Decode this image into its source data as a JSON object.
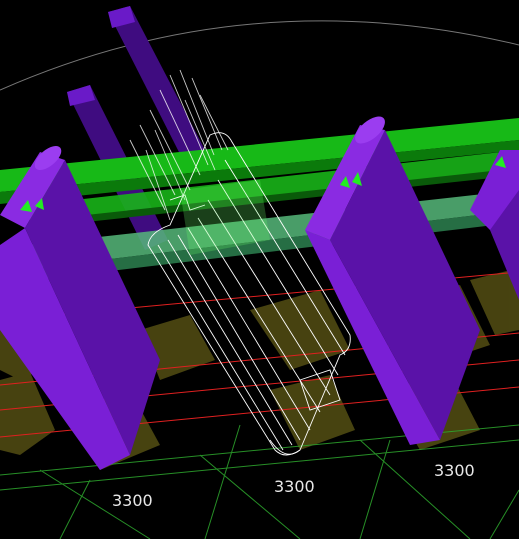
{
  "viewport": {
    "background": "#000000",
    "colors": {
      "wall_purple": "#7a1fd6",
      "wall_purple_dark": "#4a0a8f",
      "beam_green": "#19c419",
      "beam_green_translucent": "#6bd48a",
      "footing_olive": "#5a5418",
      "grid_red": "#e02020",
      "grid_green": "#2ea82e",
      "wireframe_white": "#ffffff"
    }
  },
  "selected_object": {
    "render_mode": "wireframe",
    "icon": "wireframe-wall-icon"
  },
  "dimensions": [
    {
      "label": "3300"
    },
    {
      "label": "3300"
    },
    {
      "label": "3300"
    }
  ]
}
